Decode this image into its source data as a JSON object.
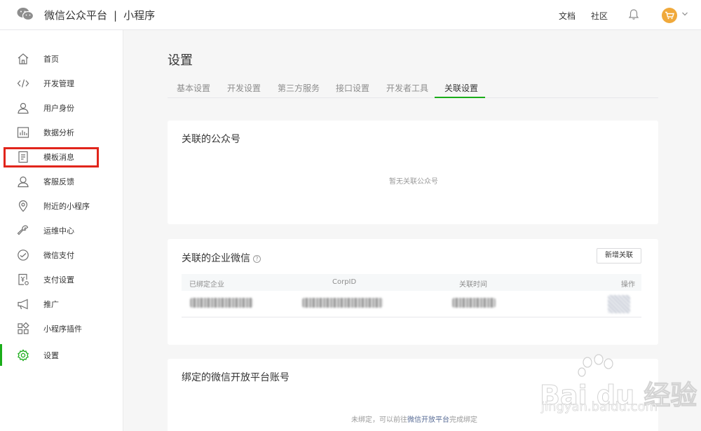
{
  "header": {
    "brand": "微信公众平台",
    "separator": "|",
    "product": "小程序",
    "links": [
      "文档",
      "社区"
    ],
    "icons": [
      "wechat-logo-icon",
      "bell-icon",
      "cart-avatar-icon",
      "chevron-down-icon"
    ]
  },
  "sidebar": {
    "items": [
      {
        "label": "首页",
        "icon": "home-icon"
      },
      {
        "label": "开发管理",
        "icon": "code-icon"
      },
      {
        "label": "用户身份",
        "icon": "user-icon"
      },
      {
        "label": "数据分析",
        "icon": "chart-icon"
      },
      {
        "label": "模板消息",
        "icon": "document-icon"
      },
      {
        "label": "客服反馈",
        "icon": "support-icon"
      },
      {
        "label": "附近的小程序",
        "icon": "location-icon"
      },
      {
        "label": "运维中心",
        "icon": "wrench-icon"
      },
      {
        "label": "微信支付",
        "icon": "payment-icon"
      },
      {
        "label": "支付设置",
        "icon": "payment-settings-icon"
      },
      {
        "label": "推广",
        "icon": "megaphone-icon"
      },
      {
        "label": "小程序插件",
        "icon": "plugin-icon"
      },
      {
        "label": "设置",
        "icon": "gear-icon"
      }
    ],
    "active_index": 12,
    "highlighted_index": 4
  },
  "main": {
    "title": "设置",
    "tabs": [
      {
        "label": "基本设置"
      },
      {
        "label": "开发设置"
      },
      {
        "label": "第三方服务"
      },
      {
        "label": "接口设置"
      },
      {
        "label": "开发者工具"
      },
      {
        "label": "关联设置"
      }
    ],
    "active_tab": 5
  },
  "linked_official_account": {
    "title": "关联的公众号",
    "empty_text": "暂无关联公众号"
  },
  "linked_enterprise_wechat": {
    "title": "关联的企业微信",
    "help": "?",
    "add_button": "新增关联",
    "columns": [
      "已绑定企业",
      "CorpID",
      "关联时间",
      "操作"
    ]
  },
  "open_platform": {
    "title": "绑定的微信开放平台账号",
    "empty_text_before": "未绑定，可以前往",
    "link_text": "微信开放平台",
    "empty_text_after": "完成绑定"
  },
  "watermark": {
    "main": "Bai du 经验",
    "sub": "jingyan.baidu.com"
  },
  "colors": {
    "accent": "#1aad19",
    "highlight": "#e1251b",
    "link": "#576b95",
    "avatar": "#f0a93b"
  }
}
